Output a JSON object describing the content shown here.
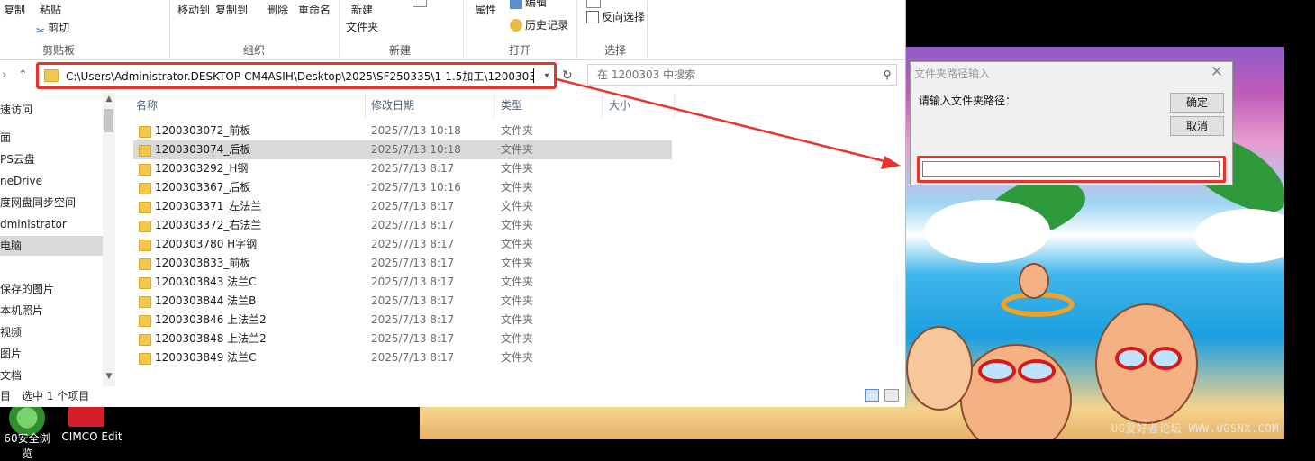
{
  "ribbon": {
    "clipboard": {
      "copy": "复制",
      "paste": "粘贴",
      "cut": "剪切",
      "group": "剪贴板"
    },
    "organize": {
      "move_to": "移动到",
      "copy_to": "复制到",
      "delete": "删除",
      "rename": "重命名",
      "group": "组织"
    },
    "new": {
      "new_folder": "新建\n文件夹",
      "new_folder_l1": "新建",
      "new_folder_l2": "文件夹",
      "group": "新建"
    },
    "open": {
      "properties": "属性",
      "edit": "编辑",
      "history": "历史记录",
      "group": "打开"
    },
    "select": {
      "invert": "反向选择",
      "group": "选择"
    }
  },
  "address": {
    "path": "C:\\Users\\Administrator.DESKTOP-CM4ASIH\\Desktop\\2025\\SF250335\\1-1.5加工\\1200303"
  },
  "search": {
    "placeholder": "在 1200303 中搜索"
  },
  "nav_pane": {
    "items": [
      {
        "label": "速访问"
      },
      {
        "label": "面"
      },
      {
        "label": "PS云盘"
      },
      {
        "label": "neDrive"
      },
      {
        "label": "度网盘同步空间"
      },
      {
        "label": "dministrator"
      },
      {
        "label": "电脑"
      },
      {
        "label": ""
      },
      {
        "label": "保存的图片"
      },
      {
        "label": "本机照片"
      },
      {
        "label": "视频"
      },
      {
        "label": "图片"
      },
      {
        "label": "文档"
      }
    ]
  },
  "columns": {
    "name": "名称",
    "date": "修改日期",
    "type": "类型",
    "size": "大小"
  },
  "files": [
    {
      "name": "1200303072_前板",
      "date": "2025/7/13 10:18",
      "type": "文件夹"
    },
    {
      "name": "1200303074_后板",
      "date": "2025/7/13 10:18",
      "type": "文件夹"
    },
    {
      "name": "1200303292_H钢",
      "date": "2025/7/13 8:17",
      "type": "文件夹"
    },
    {
      "name": "1200303367_后板",
      "date": "2025/7/13 10:16",
      "type": "文件夹"
    },
    {
      "name": "1200303371_左法兰",
      "date": "2025/7/13 8:17",
      "type": "文件夹"
    },
    {
      "name": "1200303372_右法兰",
      "date": "2025/7/13 8:17",
      "type": "文件夹"
    },
    {
      "name": "1200303780 H字钢",
      "date": "2025/7/13 8:17",
      "type": "文件夹"
    },
    {
      "name": "1200303833_前板",
      "date": "2025/7/13 8:17",
      "type": "文件夹"
    },
    {
      "name": "1200303843 法兰C",
      "date": "2025/7/13 8:17",
      "type": "文件夹"
    },
    {
      "name": "1200303844 法兰B",
      "date": "2025/7/13 8:17",
      "type": "文件夹"
    },
    {
      "name": "1200303846 上法兰2",
      "date": "2025/7/13 8:17",
      "type": "文件夹"
    },
    {
      "name": "1200303848 上法兰2",
      "date": "2025/7/13 8:17",
      "type": "文件夹"
    },
    {
      "name": "1200303849 法兰C",
      "date": "2025/7/13 8:17",
      "type": "文件夹"
    }
  ],
  "selected_index": 1,
  "status": {
    "selection": "选中 1 个项目",
    "count_prefix": "目"
  },
  "dialog": {
    "title": "文件夹路径输入",
    "prompt": "请输入文件夹路径：",
    "ok": "确定",
    "cancel": "取消",
    "input_value": ""
  },
  "desktop": {
    "icons": [
      {
        "label": "60安全浏览"
      },
      {
        "label": "CIMCO Edit"
      }
    ],
    "watermark": "UG爱好者论坛 WWW.UGSNX.COM"
  },
  "colors": {
    "highlight_red": "#e8322a",
    "folder_yellow": "#f2c94c",
    "selection_gray": "#d9d9d9"
  }
}
